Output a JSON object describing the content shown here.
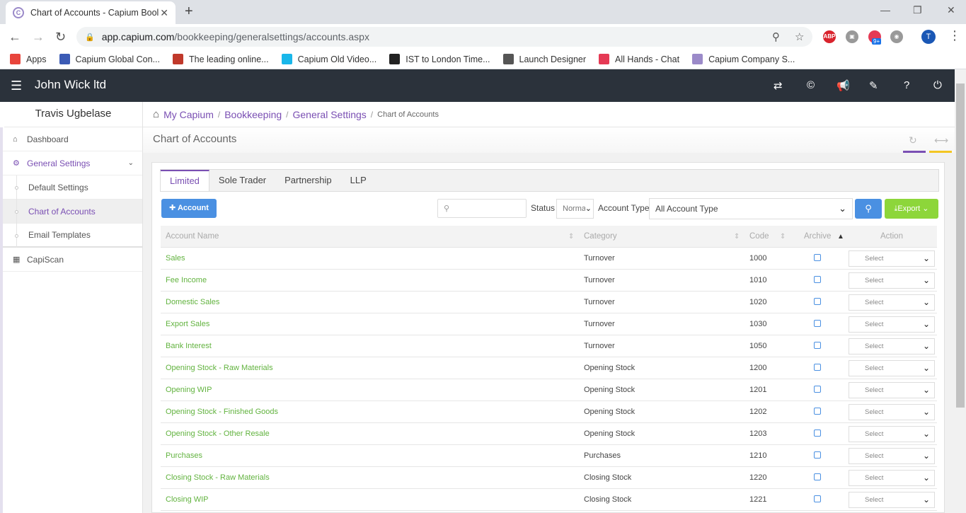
{
  "browser": {
    "tab_title": "Chart of Accounts - Capium Bool",
    "url_host": "app.capium.com",
    "url_path": "/bookkeeping/generalsettings/accounts.aspx",
    "avatar_letter": "T",
    "ext_badge": "9+",
    "bookmarks": [
      {
        "label": "Apps",
        "icon": "apps-grid-icon",
        "color": "#e8453c"
      },
      {
        "label": "Capium Global Con...",
        "icon": "doc-icon",
        "color": "#3b5bb5"
      },
      {
        "label": "The leading online...",
        "icon": "aw-icon",
        "color": "#c0392b"
      },
      {
        "label": "Capium Old Video...",
        "icon": "vimeo-icon",
        "color": "#19b7ea"
      },
      {
        "label": "IST to London Time...",
        "icon": "k-icon",
        "color": "#222222"
      },
      {
        "label": "Launch Designer",
        "icon": "globe-icon",
        "color": "#555555"
      },
      {
        "label": "All Hands - Chat",
        "icon": "chat-icon",
        "color": "#e53a55"
      },
      {
        "label": "Capium Company S...",
        "icon": "capium-icon",
        "color": "#9b8ac9"
      }
    ]
  },
  "app": {
    "company": "John Wick ltd",
    "user": "Travis Ugbelase",
    "sidebar": [
      {
        "label": "Dashboard",
        "icon": "home-icon"
      },
      {
        "label": "General Settings",
        "icon": "cogs-icon"
      },
      {
        "label": "Default Settings"
      },
      {
        "label": "Chart of Accounts"
      },
      {
        "label": "Email Templates"
      },
      {
        "label": "CapiScan",
        "icon": "scan-icon"
      }
    ],
    "breadcrumb": [
      "My Capium",
      "Bookkeeping",
      "General Settings",
      "Chart of Accounts"
    ],
    "page_title": "Chart of Accounts",
    "tabs": [
      "Limited",
      "Sole Trader",
      "Partnership",
      "LLP"
    ],
    "add_account_label": "Account",
    "status_label": "Status",
    "status_value": "Normal",
    "account_type_label": "Account Type",
    "account_type_value": "All Account Type",
    "export_label": "Export",
    "columns": [
      "Account Name",
      "Category",
      "Code",
      "Archive",
      "Action"
    ],
    "action_placeholder": "Select",
    "rows": [
      {
        "name": "Sales",
        "category": "Turnover",
        "code": "1000"
      },
      {
        "name": "Fee Income",
        "category": "Turnover",
        "code": "1010"
      },
      {
        "name": "Domestic Sales",
        "category": "Turnover",
        "code": "1020"
      },
      {
        "name": "Export Sales",
        "category": "Turnover",
        "code": "1030"
      },
      {
        "name": "Bank Interest",
        "category": "Turnover",
        "code": "1050"
      },
      {
        "name": "Opening Stock - Raw Materials",
        "category": "Opening Stock",
        "code": "1200"
      },
      {
        "name": "Opening WIP",
        "category": "Opening Stock",
        "code": "1201"
      },
      {
        "name": "Opening Stock - Finished Goods",
        "category": "Opening Stock",
        "code": "1202"
      },
      {
        "name": "Opening Stock - Other Resale",
        "category": "Opening Stock",
        "code": "1203"
      },
      {
        "name": "Purchases",
        "category": "Purchases",
        "code": "1210"
      },
      {
        "name": "Closing Stock - Raw Materials",
        "category": "Closing Stock",
        "code": "1220"
      },
      {
        "name": "Closing WIP",
        "category": "Closing Stock",
        "code": "1221"
      }
    ]
  },
  "colors": {
    "accent": "#7a4fb3",
    "link": "#62b33f",
    "primary": "#4a90e2",
    "export": "#8dd63a",
    "topbar": "#2b323b"
  }
}
